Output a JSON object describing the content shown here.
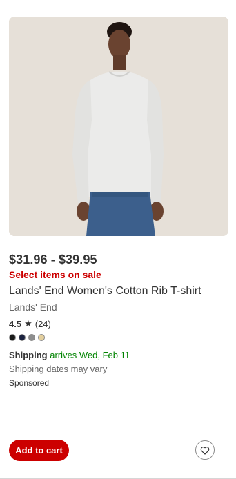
{
  "product": {
    "image_alt": "Woman wearing a long-sleeve cream cotton rib t-shirt and jeans",
    "price": "$31.96 - $39.95",
    "sale_text": "Select items on sale",
    "title": "Lands' End Women's Cotton Rib T-shirt",
    "brand": "Lands' End",
    "rating": {
      "score": "4.5",
      "star": "★",
      "count": "(24)"
    },
    "swatches": [
      {
        "name": "black",
        "color": "#1a1a1a"
      },
      {
        "name": "navy",
        "color": "#1c2340"
      },
      {
        "name": "gray",
        "color": "#8e8e8e"
      },
      {
        "name": "tan",
        "color": "#e3cf9e"
      }
    ],
    "shipping": {
      "label": "Shipping",
      "arrives": "arrives Wed, Feb 11",
      "note": "Shipping dates may vary"
    },
    "sponsored": "Sponsored"
  },
  "actions": {
    "add_to_cart": "Add to cart",
    "favorite_icon": "heart-icon"
  },
  "colors": {
    "accent_red": "#cc0000",
    "shipping_green": "#008300"
  }
}
